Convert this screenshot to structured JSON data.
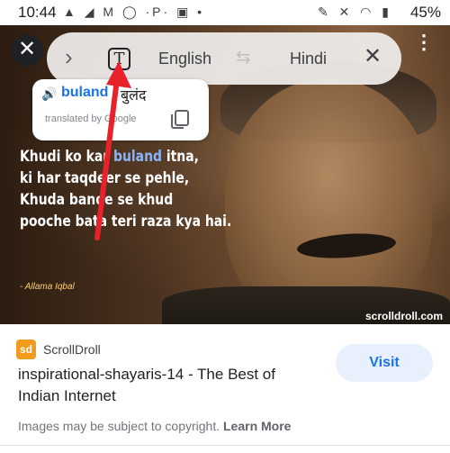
{
  "status_bar": {
    "time": "10:44",
    "left_icons": "▲ ◢ M ◯ ·P· ▣ •",
    "right_icons": "✎ ✕ ◠ ▮",
    "battery": "45%"
  },
  "image": {
    "quote_lines": [
      {
        "pre": "Khudi ko kar ",
        "highlight": "buland",
        "post": " itna,"
      },
      {
        "pre": "ki har taqdeer se pehle,",
        "highlight": "",
        "post": ""
      },
      {
        "pre": "Khuda bande se khud",
        "highlight": "",
        "post": ""
      },
      {
        "pre": "pooche bata teri raza kya hai.",
        "highlight": "",
        "post": ""
      }
    ],
    "author": "- Allama Iqbal",
    "watermark": "scrolldroll.com"
  },
  "translate_bar": {
    "close_icon_glyph": "✕",
    "chevron_glyph": "›",
    "text_mode_glyph": "T",
    "source_language": "English",
    "swap_glyph": "⇆",
    "target_language": "Hindi",
    "dismiss_glyph": "✕"
  },
  "more_glyph": "⋮",
  "translation_popup": {
    "speaker_glyph": "🔊",
    "source_word": "buland",
    "translated_word": "बुलंद",
    "credit": "translated by Google"
  },
  "result": {
    "source_logo_text": "sd",
    "source_name": "ScrollDroll",
    "title": "inspirational-shayaris-14 - The Best of Indian Internet",
    "visit_label": "Visit",
    "copyright_text": "Images may be subject to copyright.",
    "learn_more_label": "Learn More"
  },
  "colors": {
    "accent": "#1a73e8",
    "visit_bg": "#e8f0fe",
    "arrow": "#e8222a"
  }
}
